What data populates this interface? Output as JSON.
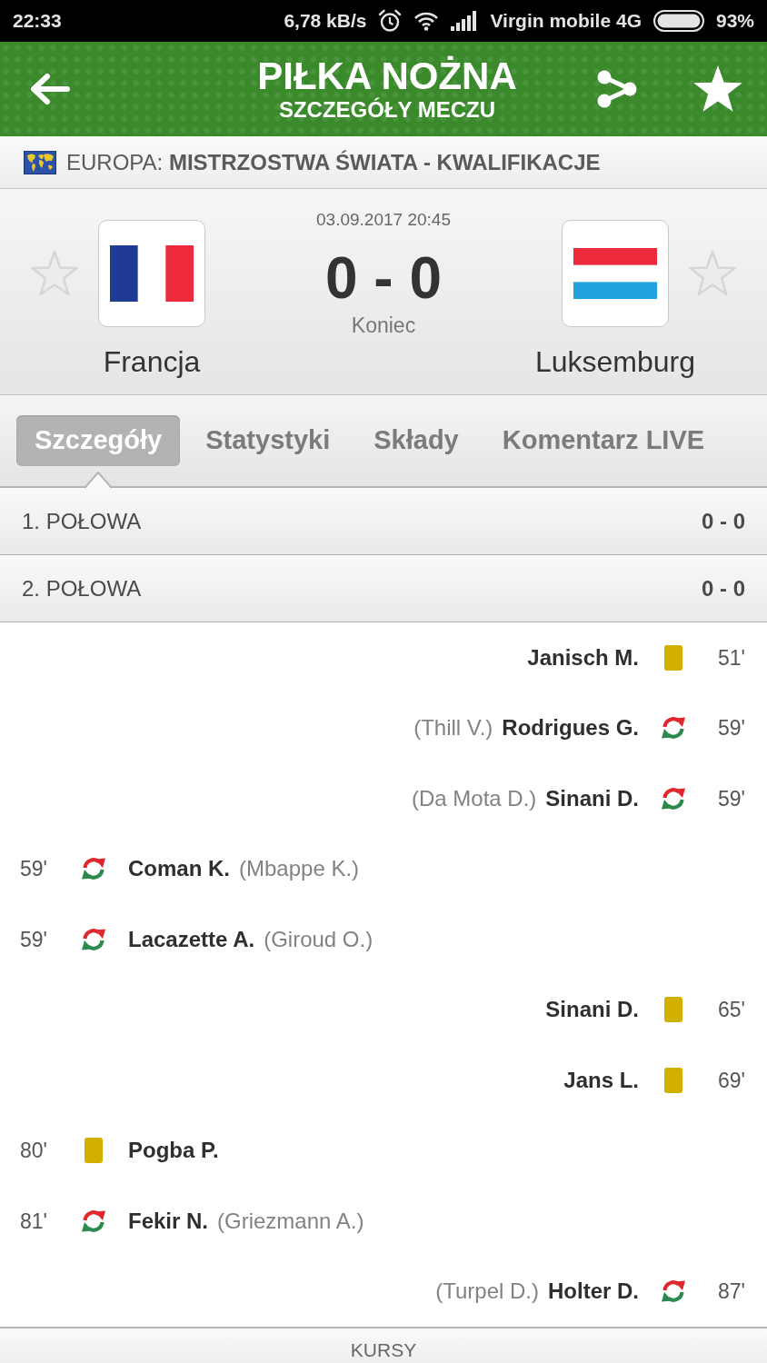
{
  "status_bar": {
    "time": "22:33",
    "speed": "6,78 kB/s",
    "carrier": "Virgin mobile 4G",
    "battery": "93%"
  },
  "header": {
    "title": "PIŁKA NOŻNA",
    "subtitle": "SZCZEGÓŁY MECZU"
  },
  "competition": "EUROPA: **MISTRZOSTWA ŚWIATA - KWALIFIKACJE**",
  "match": {
    "date": "03.09.2017 20:45",
    "score": "0 - 0",
    "status": "Koniec",
    "teams": [
      {
        "name": "Francja",
        "favorite": false,
        "flag": {
          "kind": "vertical",
          "stripes": [
            {
              "color": "#1f3b94"
            },
            {
              "color": "#ffffff"
            },
            {
              "color": "#ec2a3c"
            }
          ]
        }
      },
      {
        "name": "Luksemburg",
        "favorite": false,
        "flag": {
          "kind": "horizontal",
          "stripes": [
            {
              "color": "#ec2a3c"
            },
            {
              "color": "#ffffff"
            },
            {
              "color": "#22a3de"
            }
          ]
        }
      }
    ]
  },
  "tabs": [
    {
      "label": "Szczegóły",
      "selected": true
    },
    {
      "label": "Statystyki",
      "selected": false
    },
    {
      "label": "Składy",
      "selected": false
    },
    {
      "label": "Komentarz LIVE",
      "selected": false
    }
  ],
  "periods": [
    {
      "label": "1. POŁOWA",
      "score": "0 - 0"
    },
    {
      "label": "2. POŁOWA",
      "score": "0 - 0"
    }
  ],
  "events": [
    {
      "home": false,
      "kind": "card",
      "minute": "51'",
      "player": "Janisch M."
    },
    {
      "home": false,
      "kind": "substitution",
      "minute": "59'",
      "player": "Rodrigues G.",
      "replaced": "(Thill V.)"
    },
    {
      "home": false,
      "kind": "substitution",
      "minute": "59'",
      "player": "Sinani D.",
      "replaced": "(Da Mota D.)"
    },
    {
      "home": true,
      "kind": "substitution",
      "minute": "59'",
      "player": "Coman K.",
      "replaced": "(Mbappe K.)"
    },
    {
      "home": true,
      "kind": "substitution",
      "minute": "59'",
      "player": "Lacazette A.",
      "replaced": "(Giroud O.)"
    },
    {
      "home": false,
      "kind": "card",
      "minute": "65'",
      "player": "Sinani D."
    },
    {
      "home": false,
      "kind": "card",
      "minute": "69'",
      "player": "Jans L."
    },
    {
      "home": true,
      "kind": "card",
      "minute": "80'",
      "player": "Pogba P."
    },
    {
      "home": true,
      "kind": "substitution",
      "minute": "81'",
      "player": "Fekir N.",
      "replaced": "(Griezmann A.)"
    },
    {
      "home": false,
      "kind": "substitution",
      "minute": "87'",
      "player": "Holter D.",
      "replaced": "(Turpel D.)"
    }
  ],
  "bottom_section": {
    "label": "KURSY"
  }
}
